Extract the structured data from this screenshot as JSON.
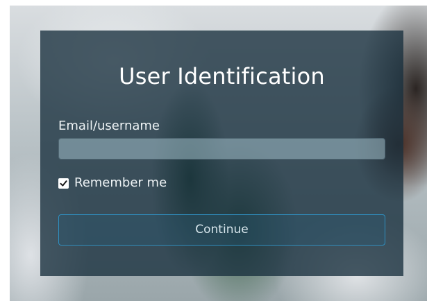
{
  "login": {
    "title": "User Identification",
    "email_label": "Email/username",
    "email_value": "",
    "remember_label": "Remember me",
    "remember_checked": true,
    "continue_label": "Continue"
  },
  "colors": {
    "panel_overlay": "#18303e",
    "button_border": "#2f8fc0",
    "text": "#ffffff"
  }
}
